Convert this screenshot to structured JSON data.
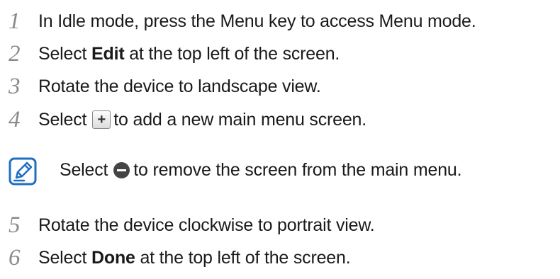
{
  "steps": [
    {
      "num": "1",
      "text": "In Idle mode, press the Menu key to access Menu mode."
    },
    {
      "num": "2",
      "pre": "Select ",
      "bold": "Edit",
      "post": " at the top left of the screen."
    },
    {
      "num": "3",
      "text": "Rotate the device to landscape view."
    },
    {
      "num": "4",
      "pre": "Select",
      "icon": "plus-icon",
      "icon_label": "+",
      "post": "to add a new main menu screen."
    },
    {
      "num": "5",
      "text": "Rotate the device clockwise to portrait view."
    },
    {
      "num": "6",
      "pre": "Select ",
      "bold": "Done",
      "post": " at the top left of the screen."
    }
  ],
  "note": {
    "icon": "note-icon",
    "pre": "Select",
    "icon_inline": "minus-icon",
    "post": "to remove the screen from the main menu."
  },
  "colors": {
    "text": "#1a1a1a",
    "step_number": "#8a8a8a",
    "note_icon": "#1e6fc1"
  }
}
